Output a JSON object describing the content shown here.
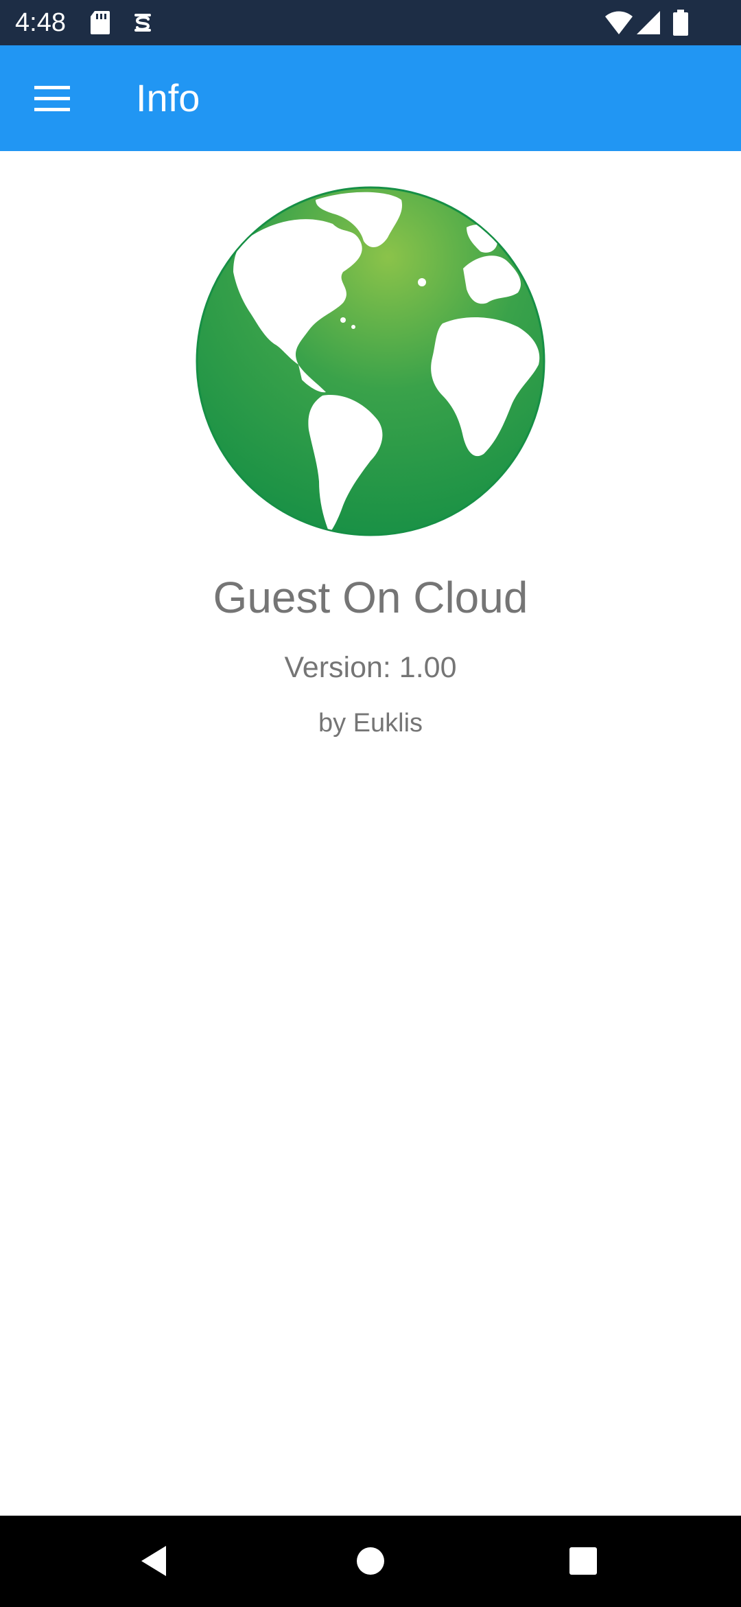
{
  "status_bar": {
    "time": "4:48",
    "icons": [
      "sd-card-icon",
      "sync-icon",
      "wifi-icon",
      "cell-signal-icon",
      "battery-icon"
    ]
  },
  "app_bar": {
    "title": "Info",
    "menu_icon": "hamburger-menu-icon",
    "background": "#2196f3"
  },
  "about": {
    "logo_icon": "globe-icon",
    "app_name": "Guest On Cloud",
    "version": "Version: 1.00",
    "author": "by Euklis"
  },
  "nav_bar": {
    "icons": [
      "back-icon",
      "home-icon",
      "recents-icon"
    ]
  },
  "colors": {
    "status_bar": "#1d2d45",
    "accent": "#2196f3",
    "globe_green": "#1e9446",
    "text_secondary": "#757575"
  }
}
